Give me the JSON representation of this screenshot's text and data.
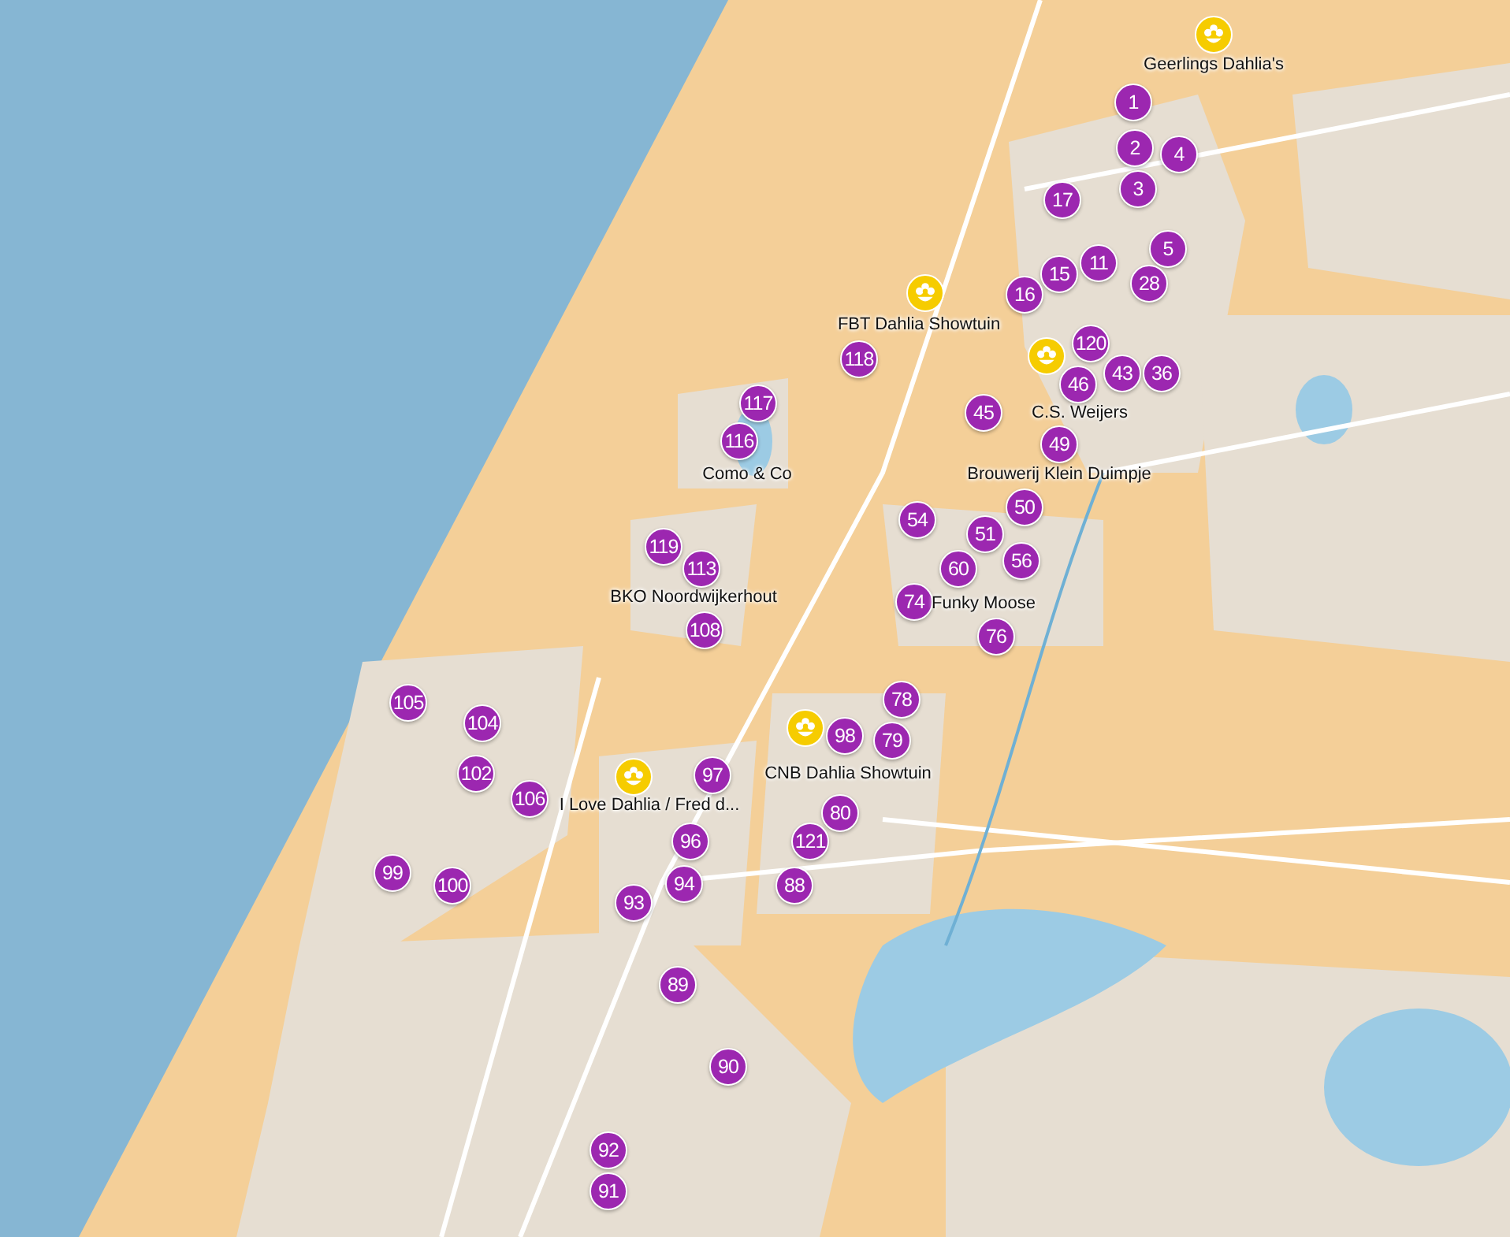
{
  "places": [
    {
      "kind": "dahlia",
      "label": "Geerlings Dahlia's"
    },
    {
      "kind": "dahlia",
      "label": "FBT Dahlia Showtuin"
    },
    {
      "kind": "dahlia",
      "label": "C.S. Weijers"
    },
    {
      "kind": "plain",
      "label": "Como & Co"
    },
    {
      "kind": "plain",
      "label": "Brouwerij Klein Duimpje"
    },
    {
      "kind": "plain",
      "label": "BKO Noordwijkerhout"
    },
    {
      "kind": "plain",
      "label": "Funky Moose"
    },
    {
      "kind": "dahlia",
      "label": "CNB Dahlia Showtuin"
    },
    {
      "kind": "dahlia",
      "label": "I Love Dahlia / Fred d..."
    }
  ],
  "markers": [
    "1",
    "2",
    "4",
    "3",
    "17",
    "5",
    "11",
    "15",
    "28",
    "16",
    "120",
    "43",
    "36",
    "46",
    "45",
    "49",
    "118",
    "117",
    "116",
    "50",
    "54",
    "51",
    "60",
    "56",
    "74",
    "76",
    "119",
    "113",
    "108",
    "105",
    "104",
    "102",
    "106",
    "97",
    "98",
    "78",
    "79",
    "80",
    "121",
    "96",
    "94",
    "93",
    "88",
    "99",
    "100",
    "89",
    "90",
    "92",
    "91"
  ]
}
